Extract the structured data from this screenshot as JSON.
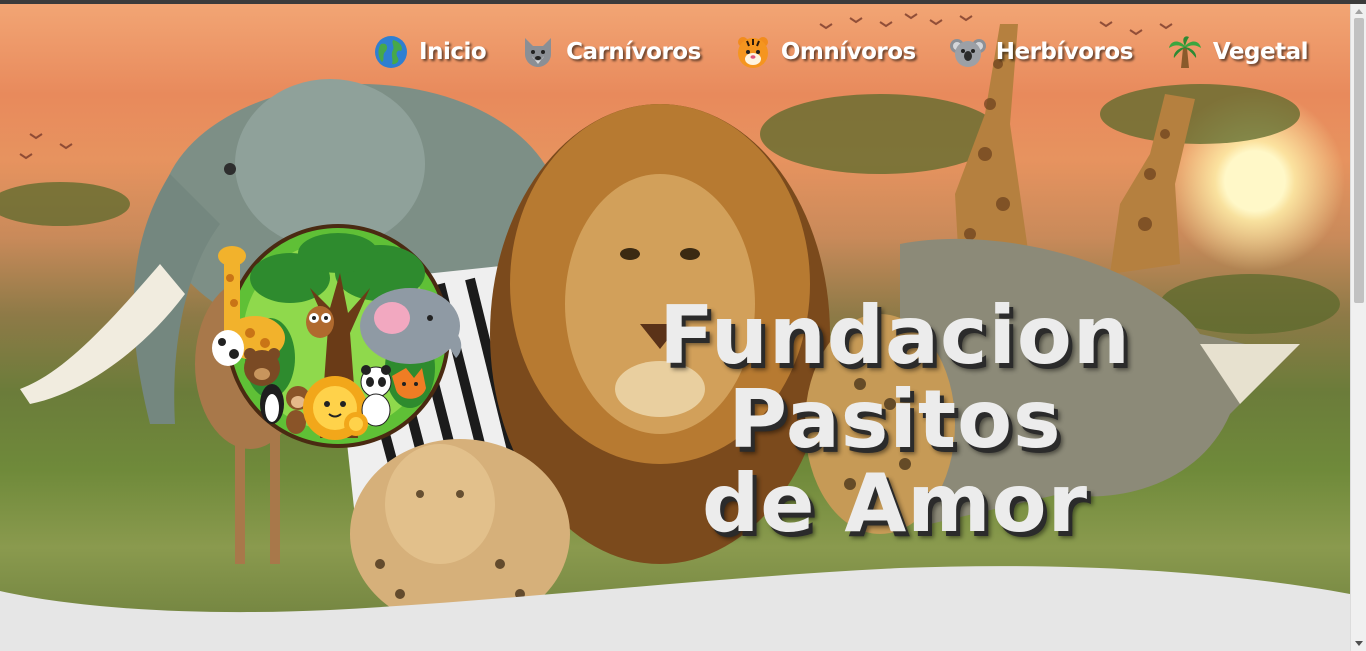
{
  "nav": {
    "items": [
      {
        "label": "Inicio",
        "icon": "globe-icon"
      },
      {
        "label": "Carnívoros",
        "icon": "wolf-icon"
      },
      {
        "label": "Omnívoros",
        "icon": "tiger-icon"
      },
      {
        "label": "Herbívoros",
        "icon": "koala-icon"
      },
      {
        "label": "Vegetal",
        "icon": "palm-tree-icon"
      }
    ]
  },
  "hero": {
    "title_line1": "Fundacion Pasitos",
    "title_line2": "de Amor"
  },
  "colors": {
    "title_fill": "#ececec",
    "title_shadow": "#2b2b2b",
    "wave": "#e6e6e6"
  }
}
